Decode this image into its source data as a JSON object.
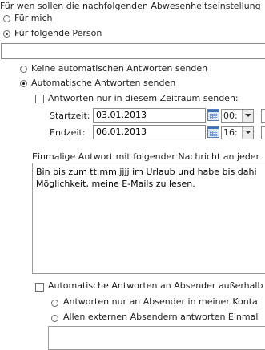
{
  "recipient": {
    "heading": "Für wen sollen die nachfolgenden Abwesenheitseinstellung",
    "option_me": "Für mich",
    "option_person": "Für folgende Person",
    "person_value": ""
  },
  "mode": {
    "no_replies": "Keine automatischen Antworten senden",
    "send_replies": "Automatische Antworten senden"
  },
  "period": {
    "checkbox_label": "Antworten nur in diesem Zeitraum senden:",
    "start_label": "Startzeit:",
    "start_date": "03.01.2013",
    "start_hour": "00:",
    "end_label": "Endzeit:",
    "end_date": "06.01.2013",
    "end_hour": "16:"
  },
  "internal_message": {
    "label": "Einmalige Antwort mit folgender Nachricht an jeder",
    "text": "Bin bis zum tt.mm.jjjj im Urlaub und habe bis dahi\nMöglichkeit, meine E-Mails zu lesen."
  },
  "external": {
    "checkbox_label": "Automatische Antworten an Absender außerhalb",
    "option_contacts": "Antworten nur an Absender in meiner Konta",
    "option_all": "Allen externen Absendern antworten Einmal",
    "text": ""
  },
  "icons": {
    "calendar": "calendar-icon",
    "dropdown": "chevron-down-icon"
  }
}
